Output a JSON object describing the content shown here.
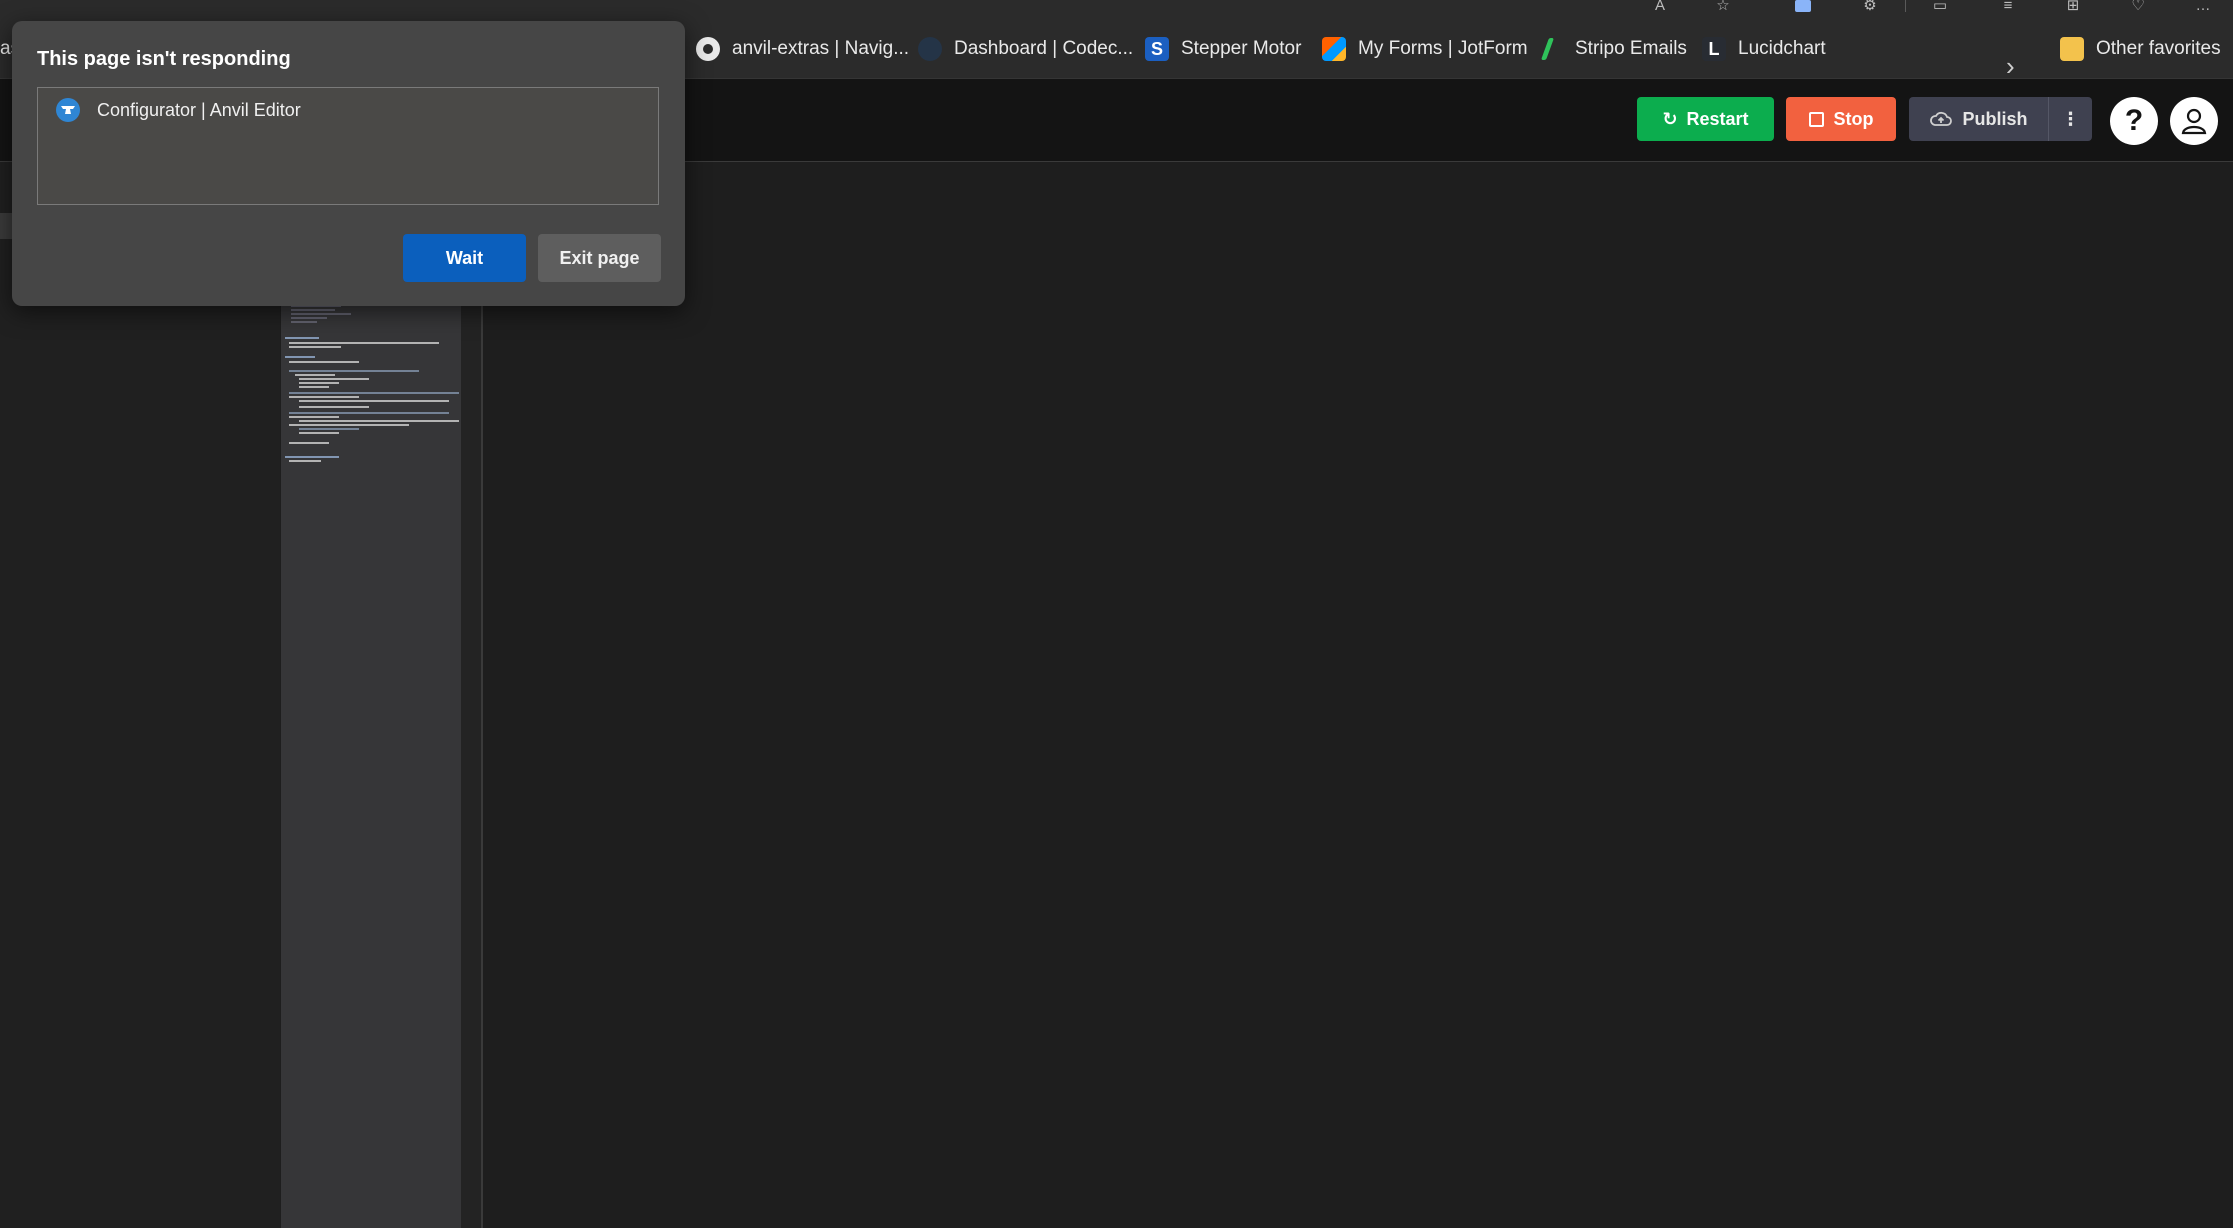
{
  "favorites": {
    "items": [
      {
        "label": "anvil-extras | Navig...",
        "icon": "github-icon"
      },
      {
        "label": "Dashboard | Codec...",
        "icon": "dashboard-icon"
      },
      {
        "label": "Stepper Motor",
        "icon": "s-logo-icon"
      },
      {
        "label": "My Forms | JotForm",
        "icon": "jotform-icon"
      },
      {
        "label": "Stripo Emails",
        "icon": "stripo-icon"
      },
      {
        "label": "Lucidchart",
        "icon": "lucidchart-icon"
      }
    ],
    "other_favorites": "Other favorites",
    "left_cut_text": "as"
  },
  "header": {
    "restart_label": "Restart",
    "stop_label": "Stop",
    "publish_label": "Publish",
    "help_label": "?",
    "colors": {
      "restart": "#0cad4e",
      "stop": "#f2613f",
      "publish": "#3f4150"
    }
  },
  "dialog": {
    "title": "This page isn't responding",
    "page_name": "Configurator | Anvil Editor",
    "wait_label": "Wait",
    "exit_label": "Exit page",
    "wait_color": "#0b5fbd"
  }
}
